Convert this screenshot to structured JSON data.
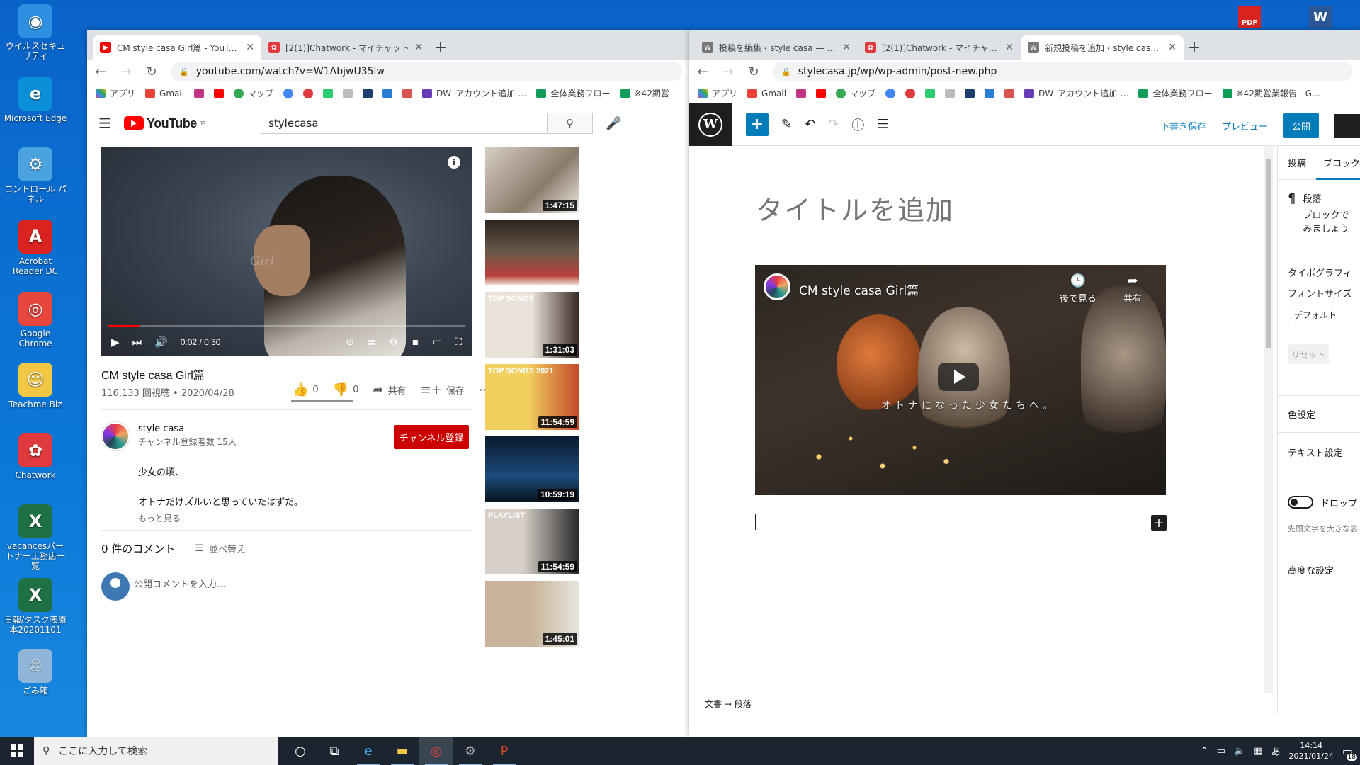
{
  "desktop": {
    "icons": [
      {
        "label": "ウイルスセキュリティ",
        "color": "#2d8fe0",
        "glyph": "◉"
      },
      {
        "label": "Microsoft Edge",
        "color": "#0c8fd9",
        "glyph": "e"
      },
      {
        "label": "コントロール パネル",
        "color": "#4aa3df",
        "glyph": "⚙"
      },
      {
        "label": "Acrobat Reader DC",
        "color": "#d9231f",
        "glyph": "A"
      },
      {
        "label": "Google Chrome",
        "color": "#e8453c",
        "glyph": "◎"
      },
      {
        "label": "Teachme Biz",
        "color": "#f2c744",
        "glyph": "☺"
      },
      {
        "label": "Chatwork",
        "color": "#e03a3e",
        "glyph": "✿"
      },
      {
        "label": "vacancesパートナー工務店一覧",
        "color": "#1e7145",
        "glyph": "X"
      },
      {
        "label": "日報/タスク表原本20201101",
        "color": "#1e7145",
        "glyph": "X"
      },
      {
        "label": "ごみ箱",
        "color": "#8fb6d9",
        "glyph": "♲"
      }
    ],
    "right_icons": [
      {
        "label": "PDF",
        "color": "#d9231f"
      },
      {
        "label": "W",
        "color": "#2b5797"
      }
    ]
  },
  "youtube_window": {
    "tabs": [
      {
        "title": "CM style casa Girl篇 - YouTube",
        "active": true,
        "icon": "youtube-favicon",
        "icon_color": "#ff0000"
      },
      {
        "title": "[2(1)]Chatwork - マイチャット",
        "active": false,
        "icon": "chatwork-favicon",
        "icon_color": "#e03a3e"
      }
    ],
    "url": "youtube.com/watch?v=W1AbjwU35lw",
    "bookmarks": [
      "アプリ",
      "Gmail",
      "",
      "",
      "マップ",
      "",
      "",
      "",
      "",
      "",
      "",
      "",
      "DW_アカウント追加-…",
      "全体業務フロー",
      "※42期営"
    ],
    "logo_text": "YouTube",
    "logo_sup": "JP",
    "search_value": "stylecasa",
    "player": {
      "time": "0:02 / 0:30",
      "progress": 0.09,
      "watermark": "Girl"
    },
    "video_title": "CM style casa Girl篇",
    "views_date": "116,133 回視聴 • 2020/04/28",
    "likes": "0",
    "dislikes": "0",
    "share": "共有",
    "save": "保存",
    "channel_name": "style casa",
    "channel_subs": "チャンネル登録者数 15人",
    "subscribe": "チャンネル登録",
    "desc_line1": "少女の頃、",
    "desc_line2": "オトナだけズルいと思っていたはずだ。",
    "show_more": "もっと見る",
    "comments_count": "0 件のコメント",
    "sort_label": "並べ替え",
    "comment_placeholder": "公開コメントを入力...",
    "recommendations": [
      {
        "duration": "1:47:15",
        "label": "",
        "bg": "linear-gradient(135deg,#d8cfc4,#8a7a6a 60%,#f0ece6)"
      },
      {
        "duration": "",
        "label": "",
        "bg": "linear-gradient(180deg,#2a2420,#6b5a4a 50%,#b8403a 85%,#f2e8dc)"
      },
      {
        "duration": "1:31:03",
        "label": "TOP SONGS",
        "bg": "linear-gradient(90deg,#e8e2d8 50%,#3a2a24 100%)"
      },
      {
        "duration": "11:54:59",
        "label": "TOP SONGS 2021",
        "bg": "linear-gradient(90deg,#f2d060 45%,#c44a2a 100%)"
      },
      {
        "duration": "10:59:19",
        "label": "",
        "bg": "linear-gradient(180deg,#0a1a2e,#1d4a7a 60%,#08131f)"
      },
      {
        "duration": "11:54:59",
        "label": "PLAYLIST",
        "bg": "linear-gradient(90deg,#d8d0c8 40%,#2a2a2a 100%)"
      },
      {
        "duration": "1:45:01",
        "label": "",
        "bg": "linear-gradient(90deg,#c8b49a 50%,#e8e4de 100%)"
      }
    ]
  },
  "wp_window": {
    "tabs": [
      {
        "title": "投稿を編集 ‹ style casa — WordPress",
        "active": false,
        "icon": "wordpress-favicon",
        "icon_color": "#555"
      },
      {
        "title": "[2(1)]Chatwork - マイチャット",
        "active": false,
        "icon": "chatwork-favicon",
        "icon_color": "#e03a3e"
      },
      {
        "title": "新規投稿を追加 ‹ style casa — WordPress",
        "active": true,
        "icon": "wordpress-favicon",
        "icon_color": "#555"
      }
    ],
    "url": "stylecasa.jp/wp/wp-admin/post-new.php",
    "bookmarks": [
      "アプリ",
      "Gmail",
      "",
      "",
      "マップ",
      "",
      "",
      "",
      "",
      "",
      "",
      "",
      "DW_アカウント追加-…",
      "全体業務フロー",
      "※42期営業報告 - G…"
    ],
    "save_draft": "下書き保存",
    "preview": "プレビュー",
    "publish": "公開",
    "title_placeholder": "タイトルを追加",
    "embed": {
      "title": "CM style casa Girl篇",
      "watch_later": "後で見る",
      "share": "共有",
      "caption": "オトナになった少女たちへ。"
    },
    "sidebar": {
      "tab_post": "投稿",
      "tab_block": "ブロック",
      "block_name": "段落",
      "block_desc1": "ブロックで",
      "block_desc2": "みましょう",
      "typography": "タイポグラフィ",
      "font_size_label": "フォントサイズ",
      "font_size_value": "デフォルト",
      "reset": "リセット",
      "color_settings": "色設定",
      "text_settings": "テキスト設定",
      "drop_cap": "ドロップ",
      "drop_cap_help": "先頭文字を大きな表",
      "advanced": "高度な設定"
    },
    "breadcrumb": "文書 → 段落"
  },
  "taskbar": {
    "search_placeholder": "ここに入力して検索",
    "apps": [
      {
        "name": "cortana-icon",
        "glyph": "○",
        "color": "#fff"
      },
      {
        "name": "task-view-icon",
        "glyph": "⧉",
        "color": "#fff"
      },
      {
        "name": "edge-icon",
        "glyph": "e",
        "color": "#3ab4f2"
      },
      {
        "name": "file-explorer-icon",
        "glyph": "▬",
        "color": "#f2c744"
      },
      {
        "name": "chrome-icon",
        "glyph": "◎",
        "color": "#e8453c"
      },
      {
        "name": "wordpress-app-icon",
        "glyph": "⚙",
        "color": "#b0b0b0"
      },
      {
        "name": "powerpoint-icon",
        "glyph": "P",
        "color": "#d24726"
      }
    ],
    "ime": "あ",
    "time": "14:14",
    "date": "2021/01/24",
    "notifications": "18"
  }
}
